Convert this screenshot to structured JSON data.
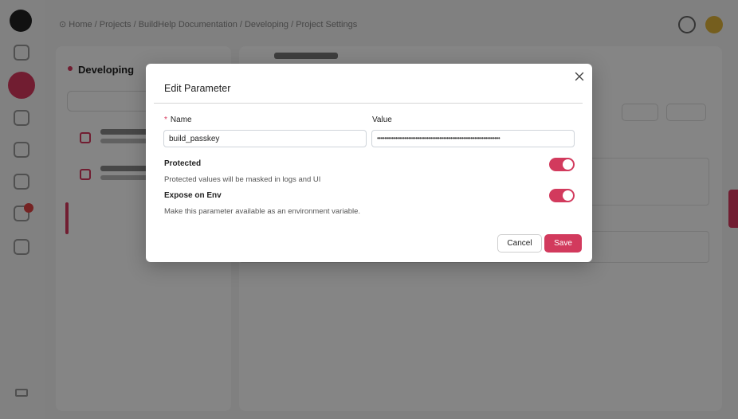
{
  "background": {
    "breadcrumb": "⊙ Home / Projects / BuildHelp Documentation / Developing / Project Settings",
    "panel_title": "Developing"
  },
  "modal": {
    "title": "Edit Parameter",
    "name_label": "Name",
    "name_required_marker": "*",
    "name_value": "build_passkey",
    "value_label": "Value",
    "value_value": "•••••••••••••••••••••••••••••••••••••••••••••••••••••••••••••••••••",
    "protected": {
      "label": "Protected",
      "description": "Protected values will be masked in logs and UI",
      "enabled": true
    },
    "expose_env": {
      "label": "Expose on Env",
      "description": "Make this parameter available as an environment variable.",
      "enabled": true
    },
    "cancel_label": "Cancel",
    "save_label": "Save"
  },
  "colors": {
    "accent": "#d23a5d",
    "overlay": "rgba(0,0,0,0.48)"
  }
}
